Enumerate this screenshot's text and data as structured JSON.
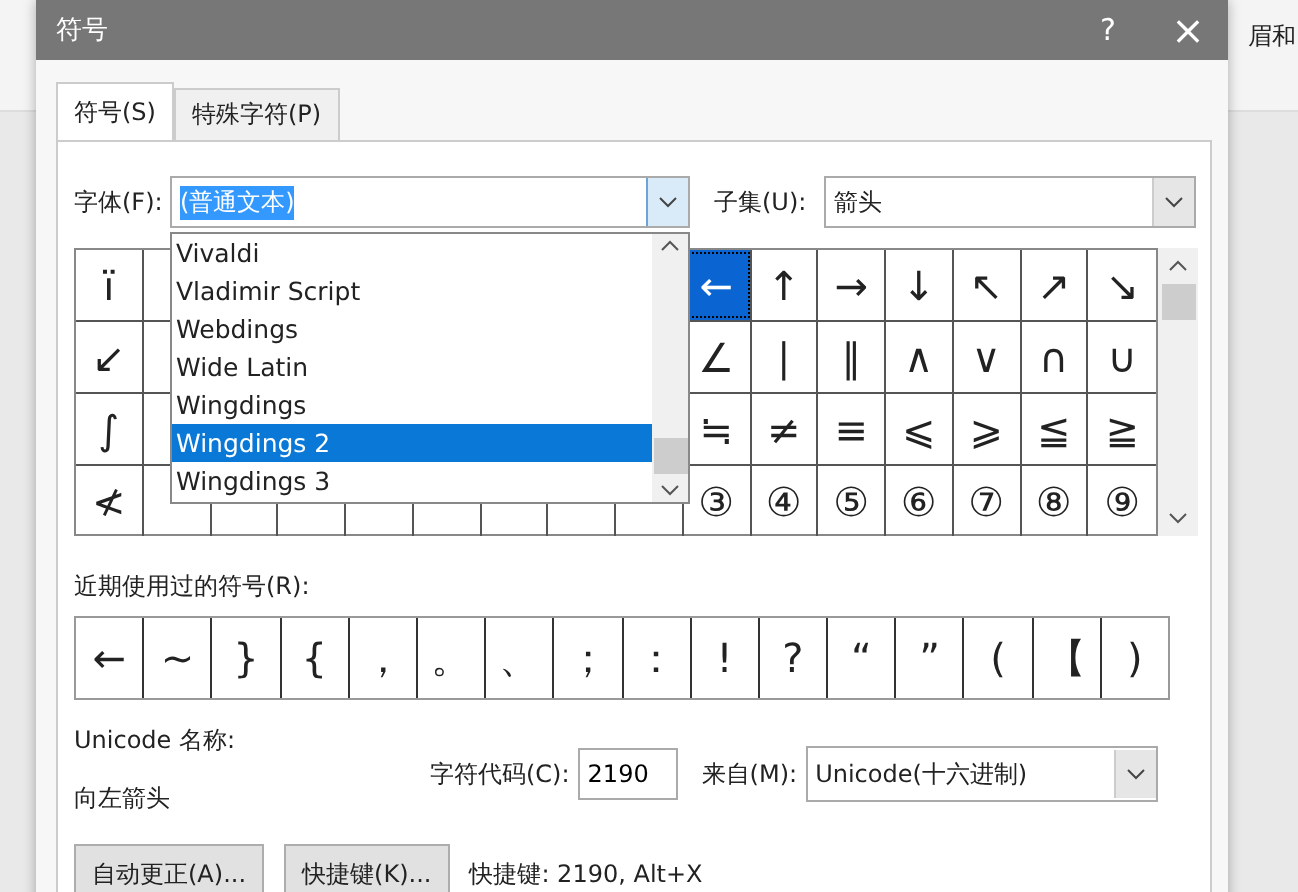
{
  "background": {
    "ribbon_text": "眉和"
  },
  "window": {
    "title": "符号",
    "help": "?",
    "close": "×"
  },
  "tabs": [
    {
      "label": "符号(S)",
      "selected": true
    },
    {
      "label": "特殊字符(P)",
      "selected": false
    }
  ],
  "font": {
    "label": "字体(F):",
    "value": "(普通文本)",
    "dropdown": [
      {
        "label": "Vivaldi",
        "selected": false
      },
      {
        "label": "Vladimir Script",
        "selected": false
      },
      {
        "label": "Webdings",
        "selected": false
      },
      {
        "label": "Wide Latin",
        "selected": false
      },
      {
        "label": "Wingdings",
        "selected": false
      },
      {
        "label": "Wingdings 2",
        "selected": true
      },
      {
        "label": "Wingdings 3",
        "selected": false
      }
    ]
  },
  "subset": {
    "label": "子集(U):",
    "value": "箭头"
  },
  "grid": {
    "rows": [
      {
        "left": "ï",
        "right": [
          {
            "symbol": "←",
            "selected": true
          },
          {
            "symbol": "↑",
            "selected": false
          },
          {
            "symbol": "→",
            "selected": false
          },
          {
            "symbol": "↓",
            "selected": false
          },
          {
            "symbol": "↖",
            "selected": false
          },
          {
            "symbol": "↗",
            "selected": false
          },
          {
            "symbol": "↘",
            "selected": false
          }
        ]
      },
      {
        "left": "↙",
        "right": [
          {
            "symbol": "∠",
            "selected": false
          },
          {
            "symbol": "∣",
            "selected": false
          },
          {
            "symbol": "∥",
            "selected": false
          },
          {
            "symbol": "∧",
            "selected": false
          },
          {
            "symbol": "∨",
            "selected": false
          },
          {
            "symbol": "∩",
            "selected": false
          },
          {
            "symbol": "∪",
            "selected": false
          }
        ]
      },
      {
        "left": "∫",
        "right": [
          {
            "symbol": "≒",
            "selected": false
          },
          {
            "symbol": "≠",
            "selected": false
          },
          {
            "symbol": "≡",
            "selected": false
          },
          {
            "symbol": "⩽",
            "selected": false
          },
          {
            "symbol": "⩾",
            "selected": false
          },
          {
            "symbol": "≦",
            "selected": false
          },
          {
            "symbol": "≧",
            "selected": false
          }
        ]
      },
      {
        "left": "≮",
        "right": [
          {
            "symbol": "③",
            "selected": false
          },
          {
            "symbol": "④",
            "selected": false
          },
          {
            "symbol": "⑤",
            "selected": false
          },
          {
            "symbol": "⑥",
            "selected": false
          },
          {
            "symbol": "⑦",
            "selected": false
          },
          {
            "symbol": "⑧",
            "selected": false
          },
          {
            "symbol": "⑨",
            "selected": false
          }
        ]
      }
    ]
  },
  "recent": {
    "label": "近期使用过的符号(R):",
    "symbols": [
      "←",
      "~",
      "}",
      "{",
      "，",
      "。",
      "、",
      "；",
      "：",
      "!",
      "?",
      "“",
      "”",
      "(",
      "【",
      ")"
    ]
  },
  "unicode_name": {
    "label": "Unicode 名称:",
    "value": "向左箭头"
  },
  "char_code": {
    "label": "字符代码(C):",
    "value": "2190"
  },
  "from": {
    "label": "来自(M):",
    "value": "Unicode(十六进制)"
  },
  "buttons": [
    "自动更正(A)...",
    "快捷键(K)..."
  ],
  "shortcut": "快捷键: 2190, Alt+X"
}
